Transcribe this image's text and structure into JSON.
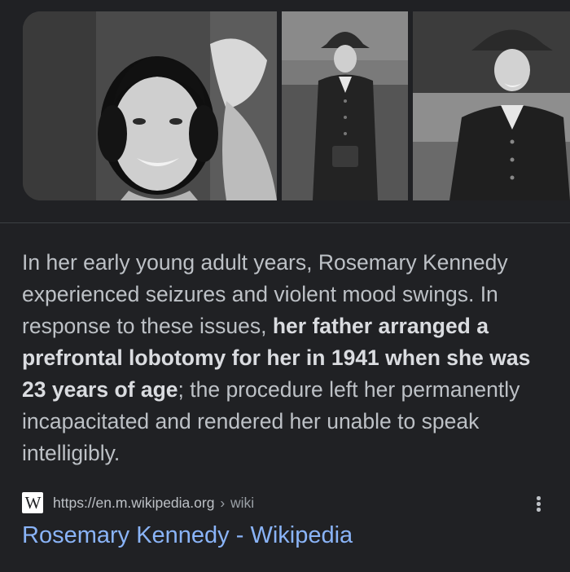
{
  "images": [
    {
      "name": "portrait-smiling",
      "alt": ""
    },
    {
      "name": "full-length-coat-hat",
      "alt": ""
    },
    {
      "name": "coat-hat-outdoors",
      "alt": ""
    }
  ],
  "snippet": {
    "text_before": "In her early young adult years, Rosemary Kennedy experienced seizures and violent mood swings. In response to these issues, ",
    "text_bold": "her father arranged a prefrontal lobotomy for her in 1941 when she was 23 years of age",
    "text_after": "; the procedure left her permanently incapacitated and rendered her unable to speak intelligibly."
  },
  "source": {
    "favicon_letter": "W",
    "url": "https://en.m.wikipedia.org",
    "separator": "›",
    "breadcrumb": "wiki"
  },
  "result": {
    "title": "Rosemary Kennedy - Wikipedia"
  },
  "colors": {
    "background": "#202124",
    "snippet_text": "#bdc1c6",
    "snippet_bold": "#dadce0",
    "link": "#8ab4f8",
    "divider": "#3c4043"
  }
}
